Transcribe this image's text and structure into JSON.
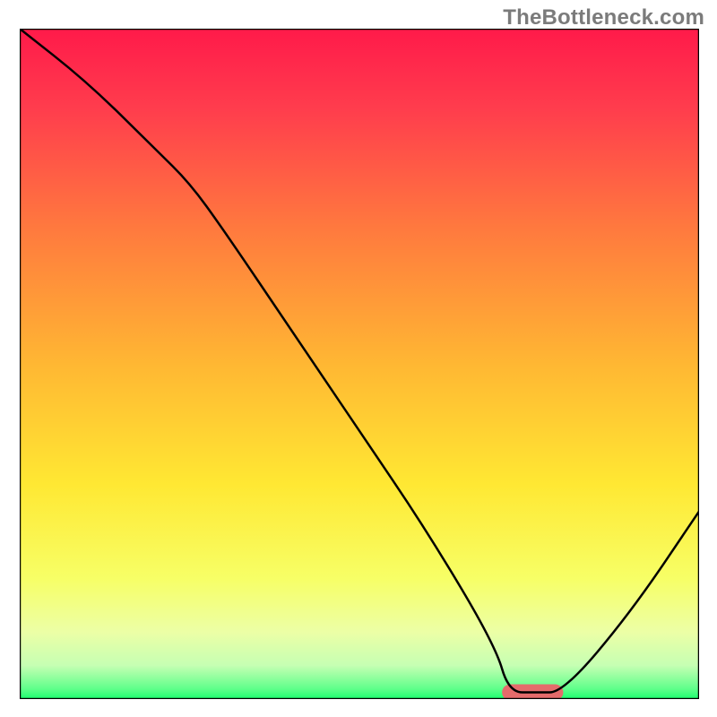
{
  "watermark": "TheBottleneck.com",
  "chart_data": {
    "type": "line",
    "title": "",
    "xlabel": "",
    "ylabel": "",
    "xlim": [
      0,
      100
    ],
    "ylim": [
      0,
      100
    ],
    "optimal_zone": {
      "x_start": 71,
      "x_end": 80,
      "y": 1
    },
    "series": [
      {
        "name": "bottleneck-curve",
        "x": [
          0,
          10,
          20,
          25,
          30,
          40,
          50,
          60,
          70,
          72,
          76,
          80,
          90,
          100
        ],
        "values": [
          100,
          92,
          82,
          77,
          70,
          55,
          40,
          25,
          8,
          1,
          1,
          1,
          13,
          28
        ]
      }
    ],
    "background_gradient": {
      "stops": [
        {
          "offset": 0.0,
          "color": "#ff1a4a"
        },
        {
          "offset": 0.12,
          "color": "#ff3d4d"
        },
        {
          "offset": 0.3,
          "color": "#ff7a3e"
        },
        {
          "offset": 0.5,
          "color": "#ffb733"
        },
        {
          "offset": 0.68,
          "color": "#ffe833"
        },
        {
          "offset": 0.82,
          "color": "#f7ff66"
        },
        {
          "offset": 0.9,
          "color": "#ecffa6"
        },
        {
          "offset": 0.95,
          "color": "#c6ffb3"
        },
        {
          "offset": 0.985,
          "color": "#5eff8a"
        },
        {
          "offset": 1.0,
          "color": "#1aff6e"
        }
      ]
    }
  }
}
